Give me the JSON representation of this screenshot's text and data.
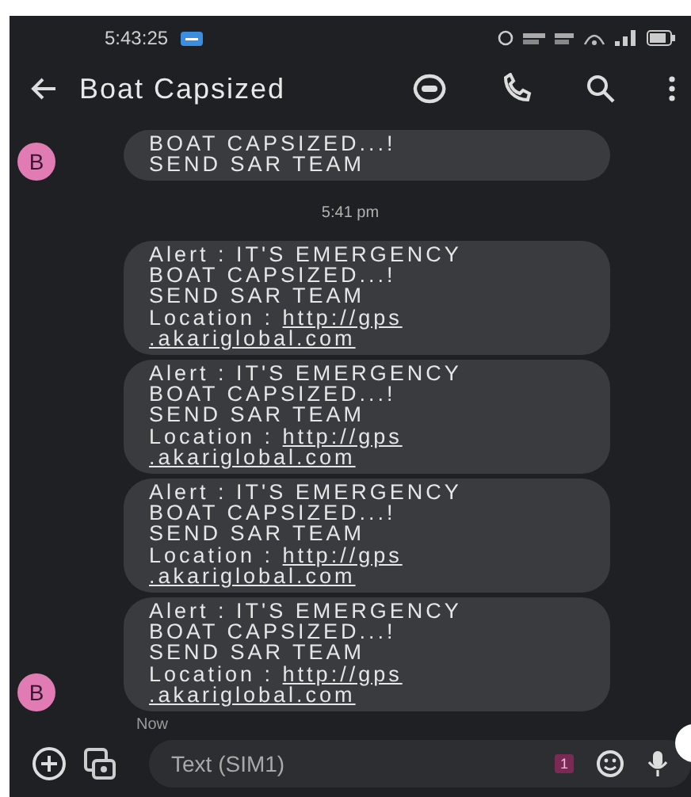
{
  "status_bar": {
    "time": "5:43:25"
  },
  "app_bar": {
    "title": "Boat Capsized"
  },
  "messages": [
    {
      "kind": "message",
      "lines": [
        "BOAT CAPSIZED...!",
        "SEND SAR TEAM"
      ],
      "avatar": "B"
    },
    {
      "kind": "timestamp",
      "text": "5:41 pm"
    },
    {
      "kind": "message",
      "lines": [
        "Alert : IT'S EMERGENCY",
        "BOAT CAPSIZED...!",
        "SEND SAR TEAM"
      ],
      "link_label": "Location : ",
      "link": [
        "http://gps",
        ".akariglobal.com"
      ]
    },
    {
      "kind": "message",
      "lines": [
        "Alert : IT'S EMERGENCY",
        "BOAT CAPSIZED...!",
        "SEND SAR TEAM"
      ],
      "link_label": "Location : ",
      "link": [
        "http://gps",
        ".akariglobal.com"
      ]
    },
    {
      "kind": "message",
      "lines": [
        "Alert : IT'S EMERGENCY",
        "BOAT CAPSIZED...!",
        "SEND SAR TEAM"
      ],
      "link_label": "Location : ",
      "link": [
        "http://gps",
        ".akariglobal.com"
      ]
    },
    {
      "kind": "message",
      "lines": [
        "Alert : IT'S EMERGENCY",
        "BOAT CAPSIZED...!",
        "SEND SAR TEAM"
      ],
      "link_label": "Location : ",
      "link": [
        "http://gps",
        ".akariglobal.com"
      ],
      "avatar": "B"
    },
    {
      "kind": "status",
      "text": "Now"
    }
  ],
  "composer": {
    "placeholder": "Text (SIM1)",
    "sim_badge": "1"
  }
}
